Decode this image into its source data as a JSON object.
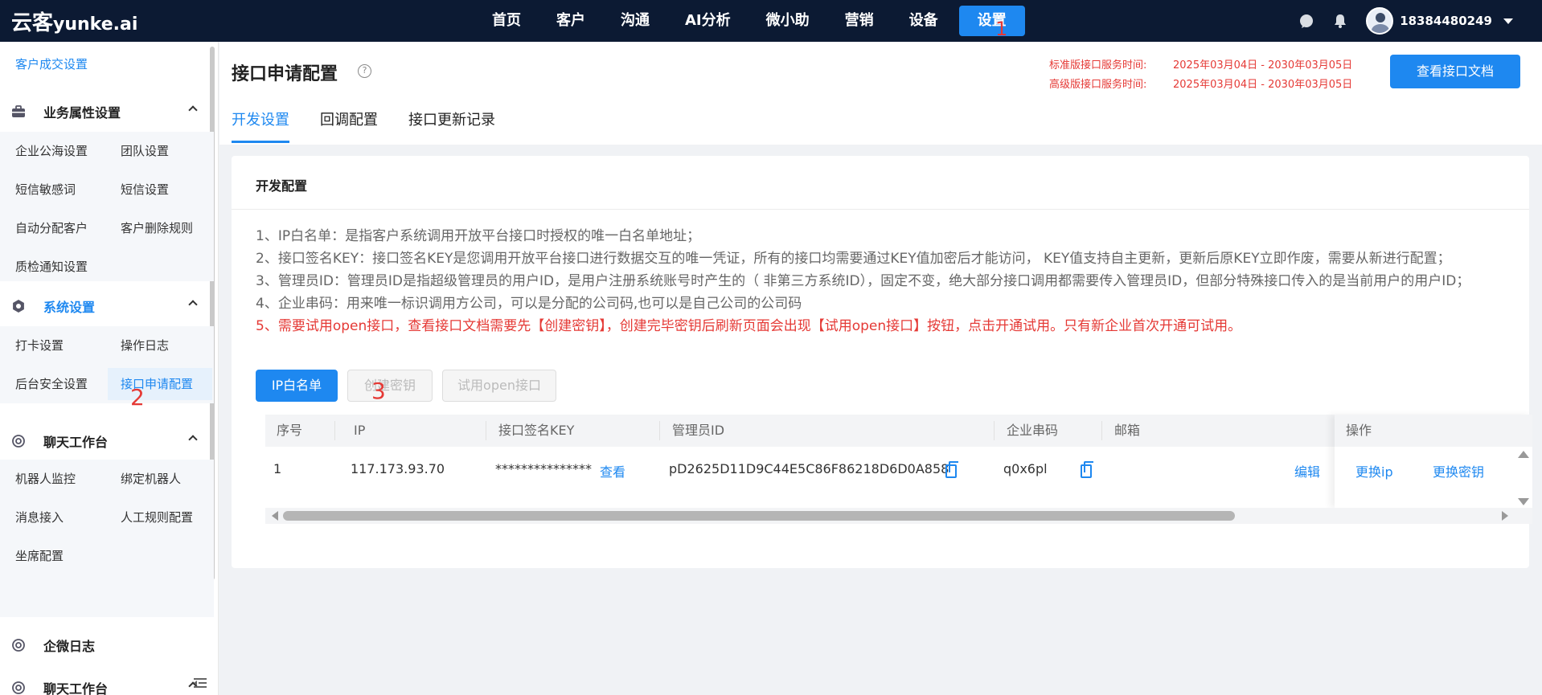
{
  "logo": {
    "cn": "云客",
    "en": "yunke.ai"
  },
  "nav": [
    {
      "label": "首页"
    },
    {
      "label": "客户"
    },
    {
      "label": "沟通"
    },
    {
      "label": "AI分析"
    },
    {
      "label": "微小助"
    },
    {
      "label": "营销"
    },
    {
      "label": "设备"
    },
    {
      "label": "设置"
    }
  ],
  "user": {
    "phone": "18384480249"
  },
  "sidebar": {
    "top_link": "客户成交设置",
    "groups": [
      {
        "title": "业务属性设置",
        "items": [
          "企业公海设置",
          "团队设置",
          "短信敏感词",
          "短信设置",
          "自动分配客户",
          "客户删除规则",
          "质检通知设置"
        ]
      },
      {
        "title": "系统设置",
        "items": [
          "打卡设置",
          "操作日志",
          "后台安全设置",
          "接口申请配置"
        ]
      },
      {
        "title": "聊天工作台",
        "items": [
          "机器人监控",
          "绑定机器人",
          "消息接入",
          "人工规则配置",
          "坐席配置"
        ]
      },
      {
        "title": "企微日志",
        "items": []
      },
      {
        "title": "聊天工作台",
        "items": []
      }
    ]
  },
  "page": {
    "title": "接口申请配置",
    "help": "?",
    "service_std_label": "标准版接口服务时间:",
    "service_std_value": "2025年03月04日 - 2030年03月05日",
    "service_adv_label": "高级版接口服务时间:",
    "service_adv_value": "2025年03月04日 - 2030年03月05日",
    "doc_button": "查看接口文档",
    "tabs": [
      "开发设置",
      "回调配置",
      "接口更新记录"
    ]
  },
  "card": {
    "title": "开发配置",
    "notes": [
      "1、IP白名单：是指客户系统调用开放平台接口时授权的唯一白名单地址；",
      "2、接口签名KEY：接口签名KEY是您调用开放平台接口进行数据交互的唯一凭证，所有的接口均需要通过KEY值加密后才能访问， KEY值支持自主更新，更新后原KEY立即作废，需要从新进行配置；",
      "3、管理员ID：管理员ID是指超级管理员的用户ID，是用户注册系统账号时产生的（ 非第三方系统ID），固定不变，绝大部分接口调用都需要传入管理员ID，但部分特殊接口传入的是当前用户的用户ID；",
      "4、企业串码：用来唯一标识调用方公司，可以是分配的公司码,也可以是自己公司的公司码",
      "5、需要试用open接口，查看接口文档需要先【创建密钥】，创建完毕密钥后刷新页面会出现【试用open接口】按钮，点击开通试用。只有新企业首次开通可试用。"
    ],
    "buttons": {
      "ip_whitelist": "IP白名单",
      "create_key": "创建密钥",
      "try_open": "试用open接口"
    },
    "table": {
      "headers": [
        "序号",
        "IP",
        "接口签名KEY",
        "管理员ID",
        "企业串码",
        "邮箱",
        "操作"
      ],
      "rows": [
        {
          "index": "1",
          "ip": "117.173.93.70",
          "key": "***************",
          "view": "查看",
          "admin_id": "pD2625D11D9C44E5C86F86218D6D0A858",
          "corp_code": "q0x6pl",
          "email": "",
          "actions": [
            "编辑",
            "更换ip",
            "更换密钥"
          ]
        }
      ]
    }
  },
  "annotations": [
    "1",
    "2",
    "3"
  ],
  "colors": {
    "nav_bg": "#0c1a33",
    "accent": "#1e88f0",
    "warning": "#e53935"
  }
}
